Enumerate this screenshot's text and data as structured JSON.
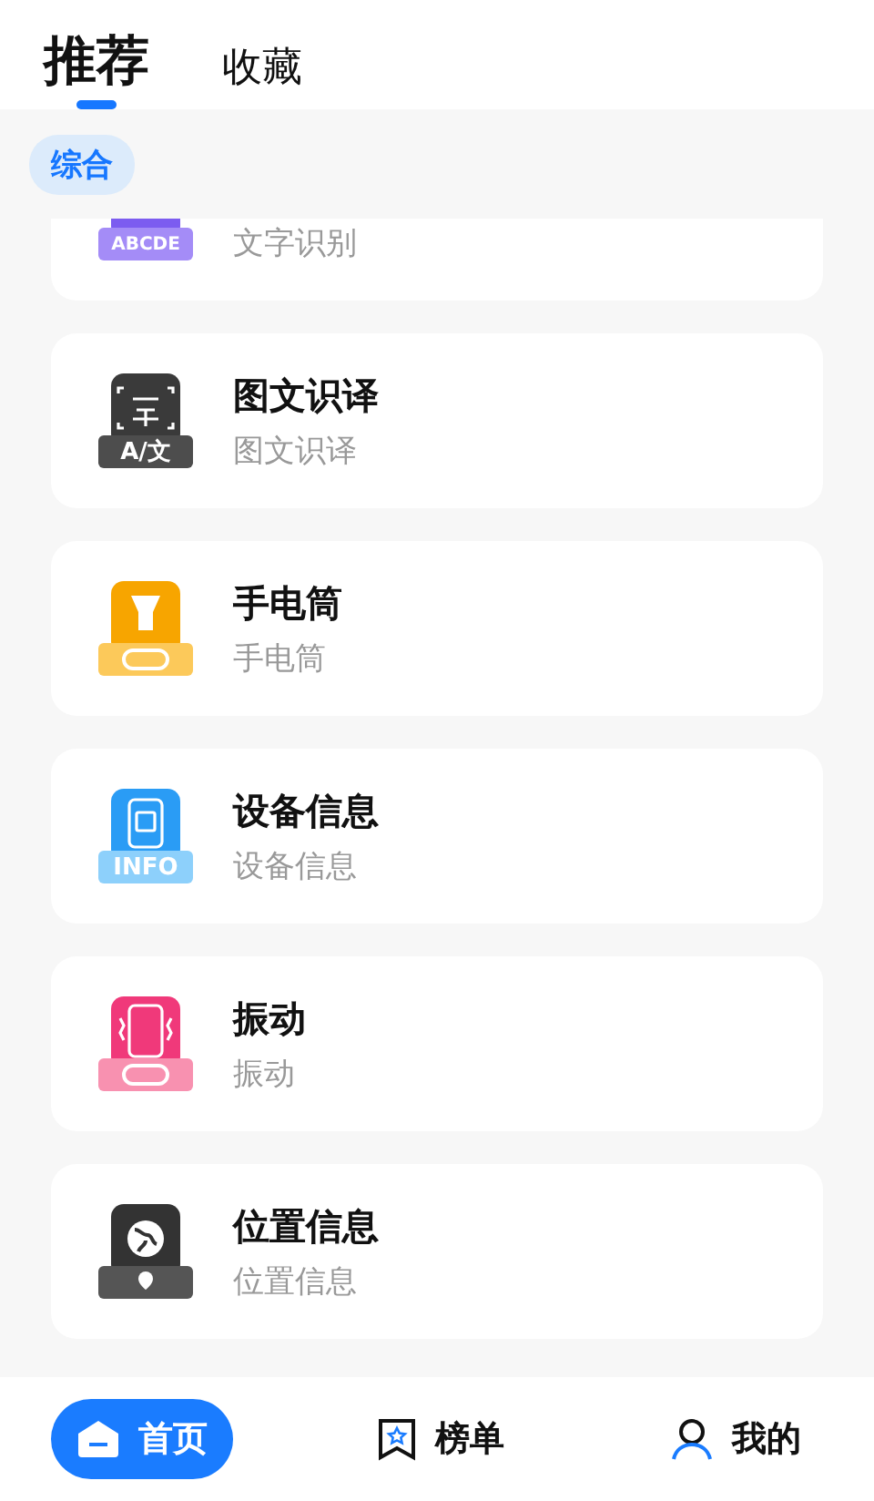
{
  "tabs": [
    {
      "label": "推荐",
      "selected": true
    },
    {
      "label": "收藏",
      "selected": false
    }
  ],
  "filters": [
    {
      "label": "综合",
      "selected": true
    }
  ],
  "tools": [
    {
      "kind": "ocr",
      "icon_text": "ABCDE",
      "subtitle": "文字识别"
    },
    {
      "kind": "translate",
      "icon_text": "A/文",
      "title": "图文识译",
      "subtitle": "图文识译"
    },
    {
      "kind": "flashlight",
      "title": "手电筒",
      "subtitle": "手电筒"
    },
    {
      "kind": "info",
      "icon_text": "INFO",
      "title": "设备信息",
      "subtitle": "设备信息"
    },
    {
      "kind": "vibrate",
      "title": "振动",
      "subtitle": "振动"
    },
    {
      "kind": "location",
      "title": "位置信息",
      "subtitle": "位置信息"
    }
  ],
  "nav": [
    {
      "label": "首页",
      "kind": "home",
      "selected": true
    },
    {
      "label": "榜单",
      "kind": "ranking",
      "selected": false
    },
    {
      "label": "我的",
      "kind": "user",
      "selected": false
    }
  ]
}
